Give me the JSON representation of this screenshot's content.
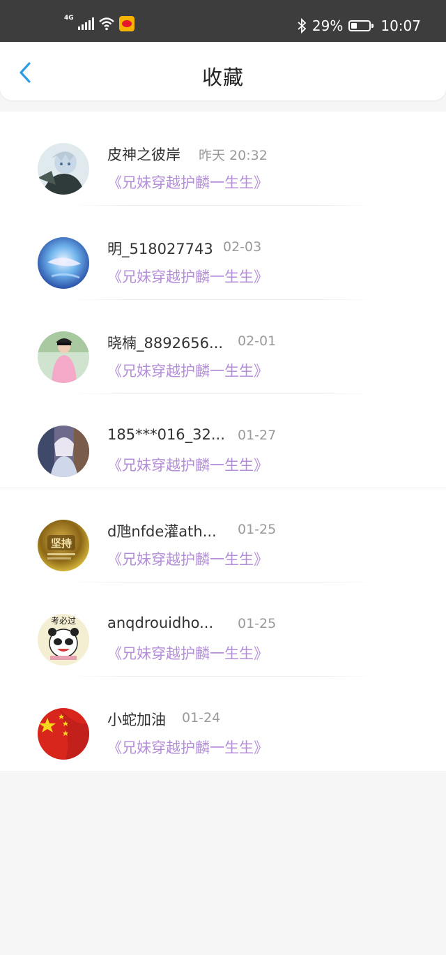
{
  "status_bar": {
    "network": "4G",
    "battery": "29%",
    "time": "10:07"
  },
  "header": {
    "title": "收藏",
    "back_icon": "chevron-left-icon"
  },
  "colors": {
    "accent": "#2e9de6",
    "link_purple": "#b48ed9"
  },
  "favorites": [
    {
      "name": "皮神之彼岸",
      "time": "昨天 20:32",
      "book": "《兄妹穿越护麟一生生》"
    },
    {
      "name": "明_518027743",
      "time": "02-03",
      "book": "《兄妹穿越护麟一生生》"
    },
    {
      "name": "晓楠_8892656...",
      "time": "02-01",
      "book": "《兄妹穿越护麟一生生》"
    },
    {
      "name": "185***016_32...",
      "time": "01-27",
      "book": "《兄妹穿越护麟一生生》"
    },
    {
      "name": "d虺nfde灌ath...",
      "time": "01-25",
      "book": "《兄妹穿越护麟一生生》"
    },
    {
      "name": "anqdrouidho...",
      "time": "01-25",
      "book": "《兄妹穿越护麟一生生》"
    },
    {
      "name": "小蛇加油",
      "time": "01-24",
      "book": "《兄妹穿越护麟一生生》"
    }
  ],
  "avatar_texts": {
    "item5_badge": "坚持",
    "item6_banner": "考必过"
  }
}
